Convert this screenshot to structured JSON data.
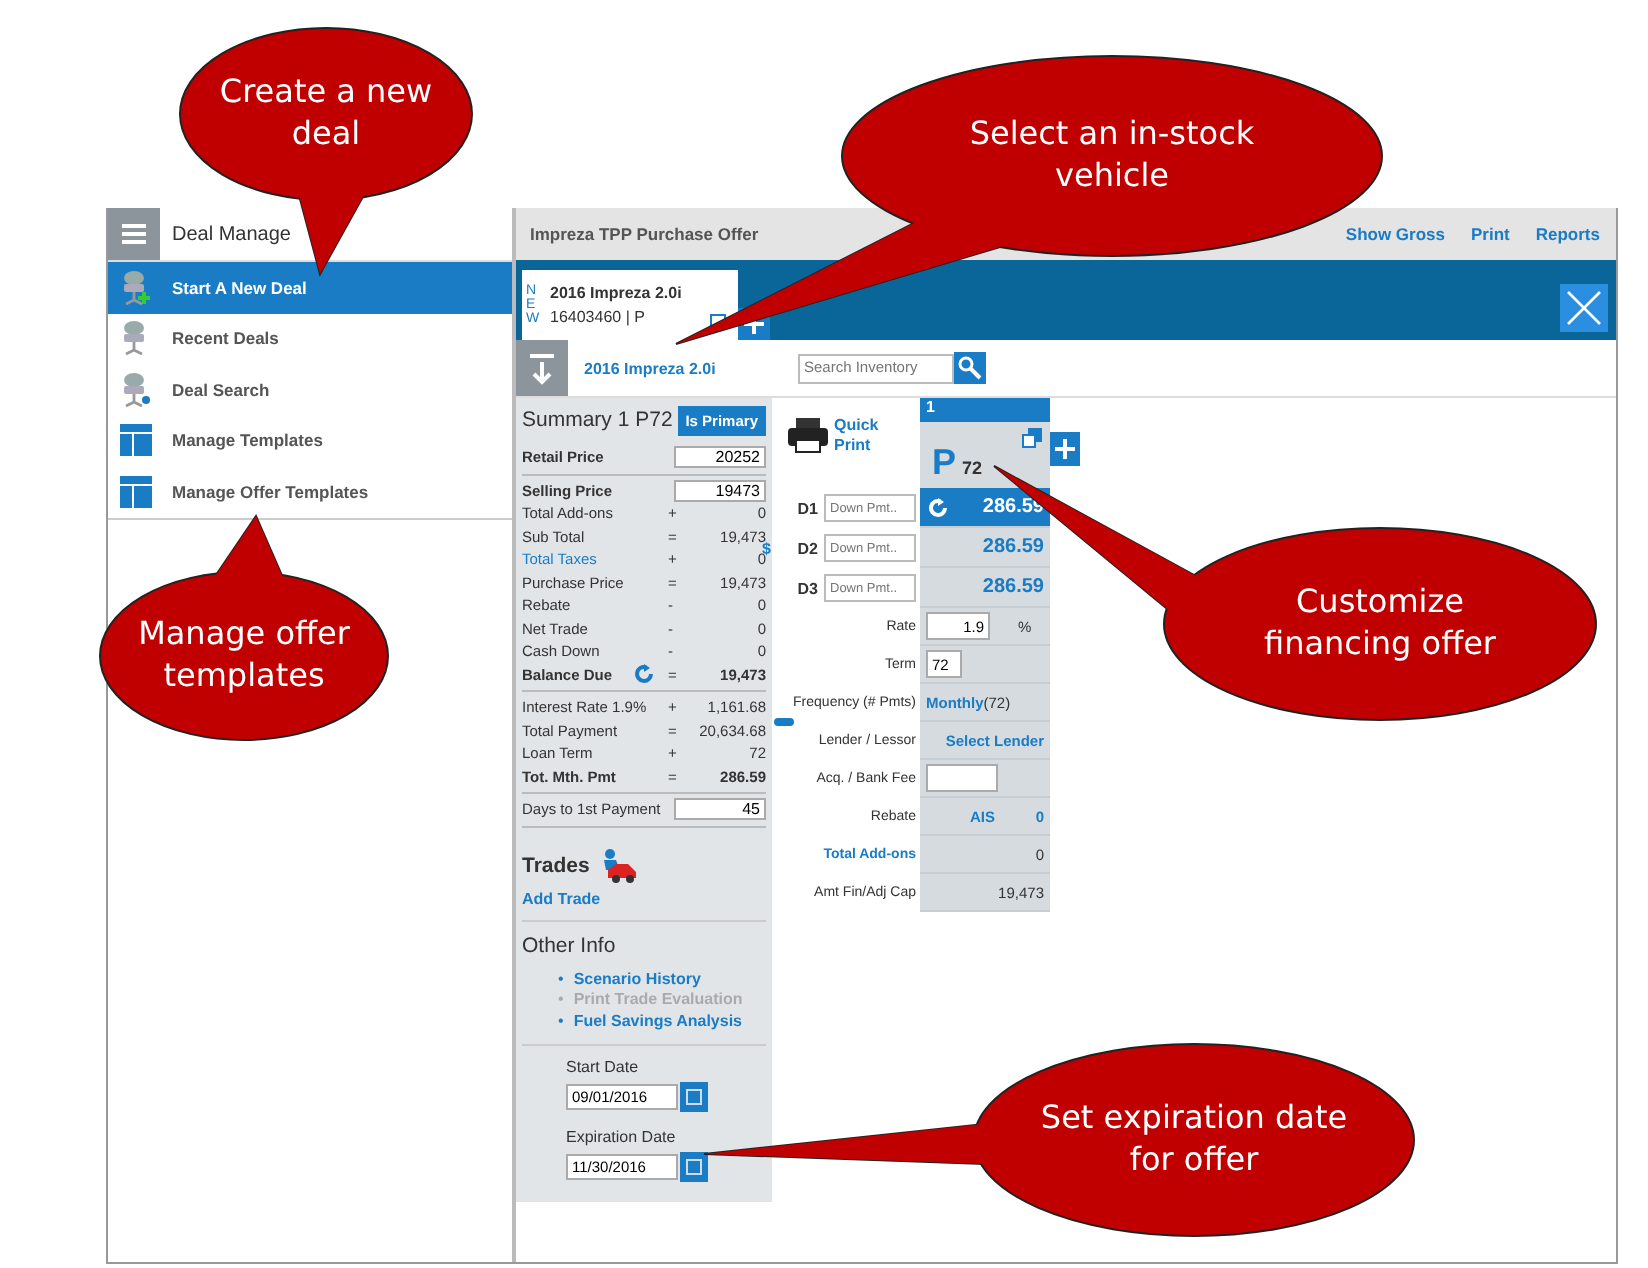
{
  "menu": {
    "title": "Deal Manage",
    "items": [
      {
        "label": "Start A New Deal",
        "kind": "new",
        "selected": true
      },
      {
        "label": "Recent Deals",
        "kind": "recent",
        "selected": false
      },
      {
        "label": "Deal Search",
        "kind": "search",
        "selected": false
      },
      {
        "label": "Manage Templates",
        "kind": "template",
        "selected": false
      },
      {
        "label": "Manage Offer Templates",
        "kind": "template",
        "selected": false
      }
    ]
  },
  "window": {
    "title": "Impreza TPP Purchase Offer",
    "links": [
      "Show Gross",
      "Print",
      "Reports"
    ]
  },
  "tab": {
    "badge": "NEW",
    "title": "2016 Impreza 2.0i",
    "subtitle": "16403460 | P"
  },
  "vehicle": {
    "name": "2016 Impreza 2.0i",
    "search_placeholder": "Search Inventory"
  },
  "summary": {
    "title": "Summary 1 P72",
    "primary_button": "Is Primary",
    "groups": [
      [
        {
          "label": "Retail Price",
          "value": "20252",
          "kind": "input_bold"
        }
      ],
      [
        {
          "label": "Selling Price",
          "value": "19473",
          "kind": "input_bold"
        },
        {
          "label": "Total Add-ons",
          "op": "+",
          "value": "0",
          "kind": "plain"
        },
        {
          "label": "Sub Total",
          "op": "=",
          "value": "19,473",
          "kind": "plain"
        },
        {
          "label": "Total Taxes",
          "op": "+",
          "value": "0",
          "kind": "link"
        },
        {
          "label": "Purchase Price",
          "op": "=",
          "value": "19,473",
          "kind": "plain"
        },
        {
          "label": "Rebate",
          "op": "-",
          "value": "0",
          "kind": "plain"
        },
        {
          "label": "Net Trade",
          "op": "-",
          "value": "0",
          "kind": "plain"
        },
        {
          "label": "Cash Down",
          "op": "-",
          "value": "0",
          "kind": "plain"
        },
        {
          "label": "Balance Due",
          "op": "=",
          "value": "19,473",
          "kind": "bold_refresh"
        }
      ],
      [
        {
          "label": "Interest Rate 1.9%",
          "op": "+",
          "value": "1,161.68",
          "kind": "plain"
        },
        {
          "label": "Total Payment",
          "op": "=",
          "value": "20,634.68",
          "kind": "plain"
        },
        {
          "label": "Loan Term",
          "op": "+",
          "value": "72",
          "kind": "plain"
        },
        {
          "label": "Tot. Mth. Pmt",
          "op": "=",
          "value": "286.59",
          "kind": "bold"
        }
      ],
      [
        {
          "label": "Days to 1st Payment",
          "value": "45",
          "kind": "input"
        }
      ]
    ]
  },
  "trades": {
    "title": "Trades",
    "link": "Add Trade"
  },
  "other_info": {
    "title": "Other Info",
    "items": [
      {
        "marker": "•",
        "label": "Scenario History",
        "disabled": false
      },
      {
        "marker": "•",
        "label": "Print Trade Evaluation",
        "disabled": true
      },
      {
        "marker": "•",
        "label": "Fuel Savings Analysis",
        "disabled": false
      }
    ]
  },
  "dates": [
    {
      "label": "Start Date",
      "value": "09/01/2016"
    },
    {
      "label": "Expiration Date",
      "value": "11/30/2016"
    }
  ],
  "offer": {
    "quick_print": "Quick Print",
    "column_number": "1",
    "column_letter": "P",
    "column_term": "72",
    "down_payments": [
      {
        "label": "D1",
        "placeholder": "Down Pmt..",
        "amount": "286.59",
        "selected": true
      },
      {
        "label": "D2",
        "prefix": "$",
        "placeholder": "Down Pmt..",
        "amount": "286.59",
        "selected": false
      },
      {
        "label": "D3",
        "placeholder": "Down Pmt..",
        "amount": "286.59",
        "selected": false
      }
    ],
    "rows": [
      {
        "label": "Rate",
        "kind": "input_unit",
        "value": "1.9",
        "unit": "%"
      },
      {
        "label": "Term",
        "kind": "input",
        "value": "72"
      },
      {
        "label": "Frequency (# Pmts)",
        "kind": "link_note",
        "value": "Monthly",
        "note": "(72)"
      },
      {
        "label": "Lender / Lessor",
        "kind": "link",
        "value": "Select Lender"
      },
      {
        "label": "Acq. / Bank Fee",
        "kind": "input",
        "value": ""
      },
      {
        "label": "Rebate",
        "kind": "link_value",
        "value": "AIS",
        "note": "0"
      },
      {
        "label": "Total Add-ons",
        "kind": "label_link",
        "value": "0"
      },
      {
        "label": "Amt Fin/Adj Cap",
        "kind": "text",
        "value": "19,473"
      }
    ]
  },
  "callouts": [
    {
      "text": "Create a new deal"
    },
    {
      "text": "Select an in-stock vehicle"
    },
    {
      "text": "Manage offer templates"
    },
    {
      "text": "Customize financing offer"
    },
    {
      "text": "Set expiration date for offer"
    }
  ]
}
